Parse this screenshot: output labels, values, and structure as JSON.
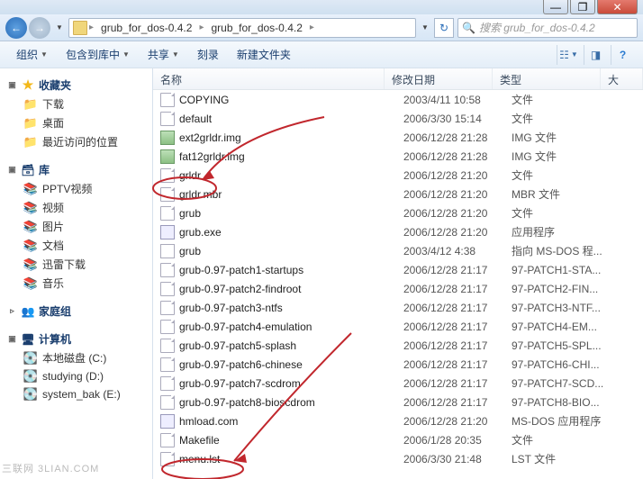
{
  "window": {
    "min": "—",
    "max": "❐",
    "close": "✕"
  },
  "breadcrumb": {
    "seg1": "grub_for_dos-0.4.2",
    "seg2": "grub_for_dos-0.4.2"
  },
  "search": {
    "placeholder": "搜索 grub_for_dos-0.4.2"
  },
  "toolbar": {
    "organize": "组织",
    "include": "包含到库中",
    "share": "共享",
    "burn": "刻录",
    "newfolder": "新建文件夹"
  },
  "sidebar": {
    "fav": {
      "label": "收藏夹",
      "items": [
        "下载",
        "桌面",
        "最近访问的位置"
      ]
    },
    "lib": {
      "label": "库",
      "items": [
        "PPTV视频",
        "视频",
        "图片",
        "文档",
        "迅雷下载",
        "音乐"
      ]
    },
    "home": {
      "label": "家庭组"
    },
    "comp": {
      "label": "计算机",
      "items": [
        "本地磁盘 (C:)",
        "studying (D:)",
        "system_bak (E:)"
      ]
    }
  },
  "columns": {
    "name": "名称",
    "date": "修改日期",
    "type": "类型",
    "size": "大"
  },
  "files": [
    {
      "name": "COPYING",
      "date": "2003/4/11 10:58",
      "type": "文件",
      "icon": "generic"
    },
    {
      "name": "default",
      "date": "2006/3/30 15:14",
      "type": "文件",
      "icon": "generic"
    },
    {
      "name": "ext2grldr.img",
      "date": "2006/12/28 21:28",
      "type": "IMG 文件",
      "icon": "img"
    },
    {
      "name": "fat12grldr.img",
      "date": "2006/12/28 21:28",
      "type": "IMG 文件",
      "icon": "img"
    },
    {
      "name": "grldr",
      "date": "2006/12/28 21:20",
      "type": "文件",
      "icon": "generic"
    },
    {
      "name": "grldr.mbr",
      "date": "2006/12/28 21:20",
      "type": "MBR 文件",
      "icon": "generic"
    },
    {
      "name": "grub",
      "date": "2006/12/28 21:20",
      "type": "文件",
      "icon": "generic"
    },
    {
      "name": "grub.exe",
      "date": "2006/12/28 21:20",
      "type": "应用程序",
      "icon": "exe"
    },
    {
      "name": "grub",
      "date": "2003/4/12 4:38",
      "type": "指向 MS-DOS 程...",
      "icon": "shortcut"
    },
    {
      "name": "grub-0.97-patch1-startups",
      "date": "2006/12/28 21:17",
      "type": "97-PATCH1-STA...",
      "icon": "generic"
    },
    {
      "name": "grub-0.97-patch2-findroot",
      "date": "2006/12/28 21:17",
      "type": "97-PATCH2-FIN...",
      "icon": "generic"
    },
    {
      "name": "grub-0.97-patch3-ntfs",
      "date": "2006/12/28 21:17",
      "type": "97-PATCH3-NTF...",
      "icon": "generic"
    },
    {
      "name": "grub-0.97-patch4-emulation",
      "date": "2006/12/28 21:17",
      "type": "97-PATCH4-EM...",
      "icon": "generic"
    },
    {
      "name": "grub-0.97-patch5-splash",
      "date": "2006/12/28 21:17",
      "type": "97-PATCH5-SPL...",
      "icon": "generic"
    },
    {
      "name": "grub-0.97-patch6-chinese",
      "date": "2006/12/28 21:17",
      "type": "97-PATCH6-CHI...",
      "icon": "generic"
    },
    {
      "name": "grub-0.97-patch7-scdrom",
      "date": "2006/12/28 21:17",
      "type": "97-PATCH7-SCD...",
      "icon": "generic"
    },
    {
      "name": "grub-0.97-patch8-bioscdrom",
      "date": "2006/12/28 21:17",
      "type": "97-PATCH8-BIO...",
      "icon": "generic"
    },
    {
      "name": "hmload.com",
      "date": "2006/12/28 21:20",
      "type": "MS-DOS 应用程序",
      "icon": "exe"
    },
    {
      "name": "Makefile",
      "date": "2006/1/28 20:35",
      "type": "文件",
      "icon": "generic"
    },
    {
      "name": "menu.lst",
      "date": "2006/3/30 21:48",
      "type": "LST 文件",
      "icon": "generic"
    }
  ],
  "watermark": "三联网 3LIAN.COM"
}
